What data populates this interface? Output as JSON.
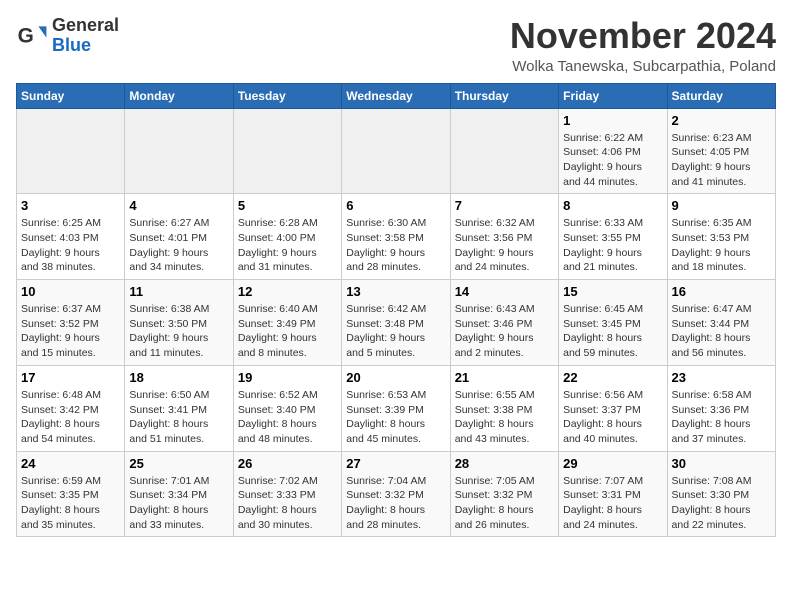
{
  "header": {
    "logo_general": "General",
    "logo_blue": "Blue",
    "month_title": "November 2024",
    "location": "Wolka Tanewska, Subcarpathia, Poland"
  },
  "weekdays": [
    "Sunday",
    "Monday",
    "Tuesday",
    "Wednesday",
    "Thursday",
    "Friday",
    "Saturday"
  ],
  "weeks": [
    [
      {
        "day": "",
        "info": ""
      },
      {
        "day": "",
        "info": ""
      },
      {
        "day": "",
        "info": ""
      },
      {
        "day": "",
        "info": ""
      },
      {
        "day": "",
        "info": ""
      },
      {
        "day": "1",
        "info": "Sunrise: 6:22 AM\nSunset: 4:06 PM\nDaylight: 9 hours\nand 44 minutes."
      },
      {
        "day": "2",
        "info": "Sunrise: 6:23 AM\nSunset: 4:05 PM\nDaylight: 9 hours\nand 41 minutes."
      }
    ],
    [
      {
        "day": "3",
        "info": "Sunrise: 6:25 AM\nSunset: 4:03 PM\nDaylight: 9 hours\nand 38 minutes."
      },
      {
        "day": "4",
        "info": "Sunrise: 6:27 AM\nSunset: 4:01 PM\nDaylight: 9 hours\nand 34 minutes."
      },
      {
        "day": "5",
        "info": "Sunrise: 6:28 AM\nSunset: 4:00 PM\nDaylight: 9 hours\nand 31 minutes."
      },
      {
        "day": "6",
        "info": "Sunrise: 6:30 AM\nSunset: 3:58 PM\nDaylight: 9 hours\nand 28 minutes."
      },
      {
        "day": "7",
        "info": "Sunrise: 6:32 AM\nSunset: 3:56 PM\nDaylight: 9 hours\nand 24 minutes."
      },
      {
        "day": "8",
        "info": "Sunrise: 6:33 AM\nSunset: 3:55 PM\nDaylight: 9 hours\nand 21 minutes."
      },
      {
        "day": "9",
        "info": "Sunrise: 6:35 AM\nSunset: 3:53 PM\nDaylight: 9 hours\nand 18 minutes."
      }
    ],
    [
      {
        "day": "10",
        "info": "Sunrise: 6:37 AM\nSunset: 3:52 PM\nDaylight: 9 hours\nand 15 minutes."
      },
      {
        "day": "11",
        "info": "Sunrise: 6:38 AM\nSunset: 3:50 PM\nDaylight: 9 hours\nand 11 minutes."
      },
      {
        "day": "12",
        "info": "Sunrise: 6:40 AM\nSunset: 3:49 PM\nDaylight: 9 hours\nand 8 minutes."
      },
      {
        "day": "13",
        "info": "Sunrise: 6:42 AM\nSunset: 3:48 PM\nDaylight: 9 hours\nand 5 minutes."
      },
      {
        "day": "14",
        "info": "Sunrise: 6:43 AM\nSunset: 3:46 PM\nDaylight: 9 hours\nand 2 minutes."
      },
      {
        "day": "15",
        "info": "Sunrise: 6:45 AM\nSunset: 3:45 PM\nDaylight: 8 hours\nand 59 minutes."
      },
      {
        "day": "16",
        "info": "Sunrise: 6:47 AM\nSunset: 3:44 PM\nDaylight: 8 hours\nand 56 minutes."
      }
    ],
    [
      {
        "day": "17",
        "info": "Sunrise: 6:48 AM\nSunset: 3:42 PM\nDaylight: 8 hours\nand 54 minutes."
      },
      {
        "day": "18",
        "info": "Sunrise: 6:50 AM\nSunset: 3:41 PM\nDaylight: 8 hours\nand 51 minutes."
      },
      {
        "day": "19",
        "info": "Sunrise: 6:52 AM\nSunset: 3:40 PM\nDaylight: 8 hours\nand 48 minutes."
      },
      {
        "day": "20",
        "info": "Sunrise: 6:53 AM\nSunset: 3:39 PM\nDaylight: 8 hours\nand 45 minutes."
      },
      {
        "day": "21",
        "info": "Sunrise: 6:55 AM\nSunset: 3:38 PM\nDaylight: 8 hours\nand 43 minutes."
      },
      {
        "day": "22",
        "info": "Sunrise: 6:56 AM\nSunset: 3:37 PM\nDaylight: 8 hours\nand 40 minutes."
      },
      {
        "day": "23",
        "info": "Sunrise: 6:58 AM\nSunset: 3:36 PM\nDaylight: 8 hours\nand 37 minutes."
      }
    ],
    [
      {
        "day": "24",
        "info": "Sunrise: 6:59 AM\nSunset: 3:35 PM\nDaylight: 8 hours\nand 35 minutes."
      },
      {
        "day": "25",
        "info": "Sunrise: 7:01 AM\nSunset: 3:34 PM\nDaylight: 8 hours\nand 33 minutes."
      },
      {
        "day": "26",
        "info": "Sunrise: 7:02 AM\nSunset: 3:33 PM\nDaylight: 8 hours\nand 30 minutes."
      },
      {
        "day": "27",
        "info": "Sunrise: 7:04 AM\nSunset: 3:32 PM\nDaylight: 8 hours\nand 28 minutes."
      },
      {
        "day": "28",
        "info": "Sunrise: 7:05 AM\nSunset: 3:32 PM\nDaylight: 8 hours\nand 26 minutes."
      },
      {
        "day": "29",
        "info": "Sunrise: 7:07 AM\nSunset: 3:31 PM\nDaylight: 8 hours\nand 24 minutes."
      },
      {
        "day": "30",
        "info": "Sunrise: 7:08 AM\nSunset: 3:30 PM\nDaylight: 8 hours\nand 22 minutes."
      }
    ]
  ]
}
